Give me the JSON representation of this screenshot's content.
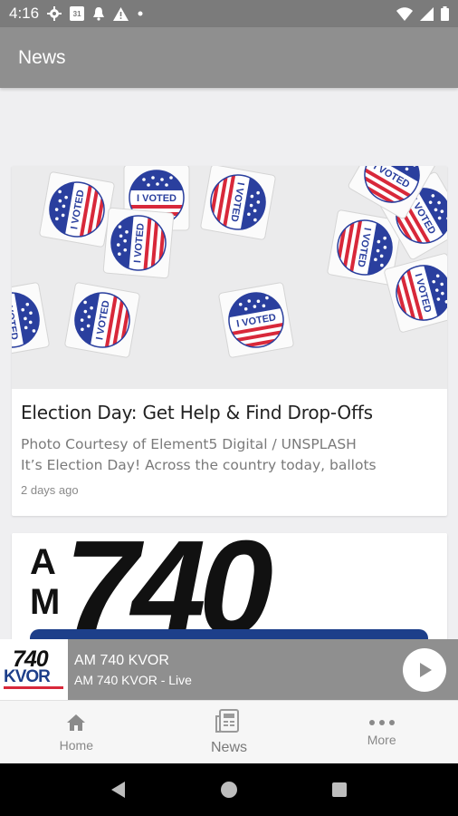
{
  "status_bar": {
    "time": "4:16",
    "calendar_day": "31",
    "icons": [
      "gear-icon",
      "calendar-icon",
      "bell-icon",
      "warning-icon",
      "dot-icon",
      "wifi-icon",
      "signal-icon",
      "battery-icon"
    ]
  },
  "app_bar": {
    "title": "News"
  },
  "articles": [
    {
      "title": "Election Day: Get Help & Find Drop-Offs",
      "excerpt_line1": "Photo Courtesy of Element5 Digital / UNSPLASH",
      "excerpt_line2": "It’s Election Day! Across the country today, ballots",
      "time": "2 days ago",
      "image_sticker_text": "I VOTED"
    },
    {
      "image_text_am": "AM",
      "image_text_freq": "740"
    }
  ],
  "player": {
    "logo_freq": "740",
    "logo_call": "KVOR",
    "title": "AM 740 KVOR",
    "subtitle": "AM 740 KVOR - Live"
  },
  "bottom_nav": [
    {
      "label": "Home",
      "icon": "home-icon",
      "active": false
    },
    {
      "label": "News",
      "icon": "newspaper-icon",
      "active": true
    },
    {
      "label": "More",
      "icon": "more-dots-icon",
      "active": false
    }
  ],
  "colors": {
    "bar": "#8f8f8f",
    "status": "#7b7b7b",
    "sticker_blue": "#2a3f9e",
    "sticker_red": "#d8283a"
  }
}
